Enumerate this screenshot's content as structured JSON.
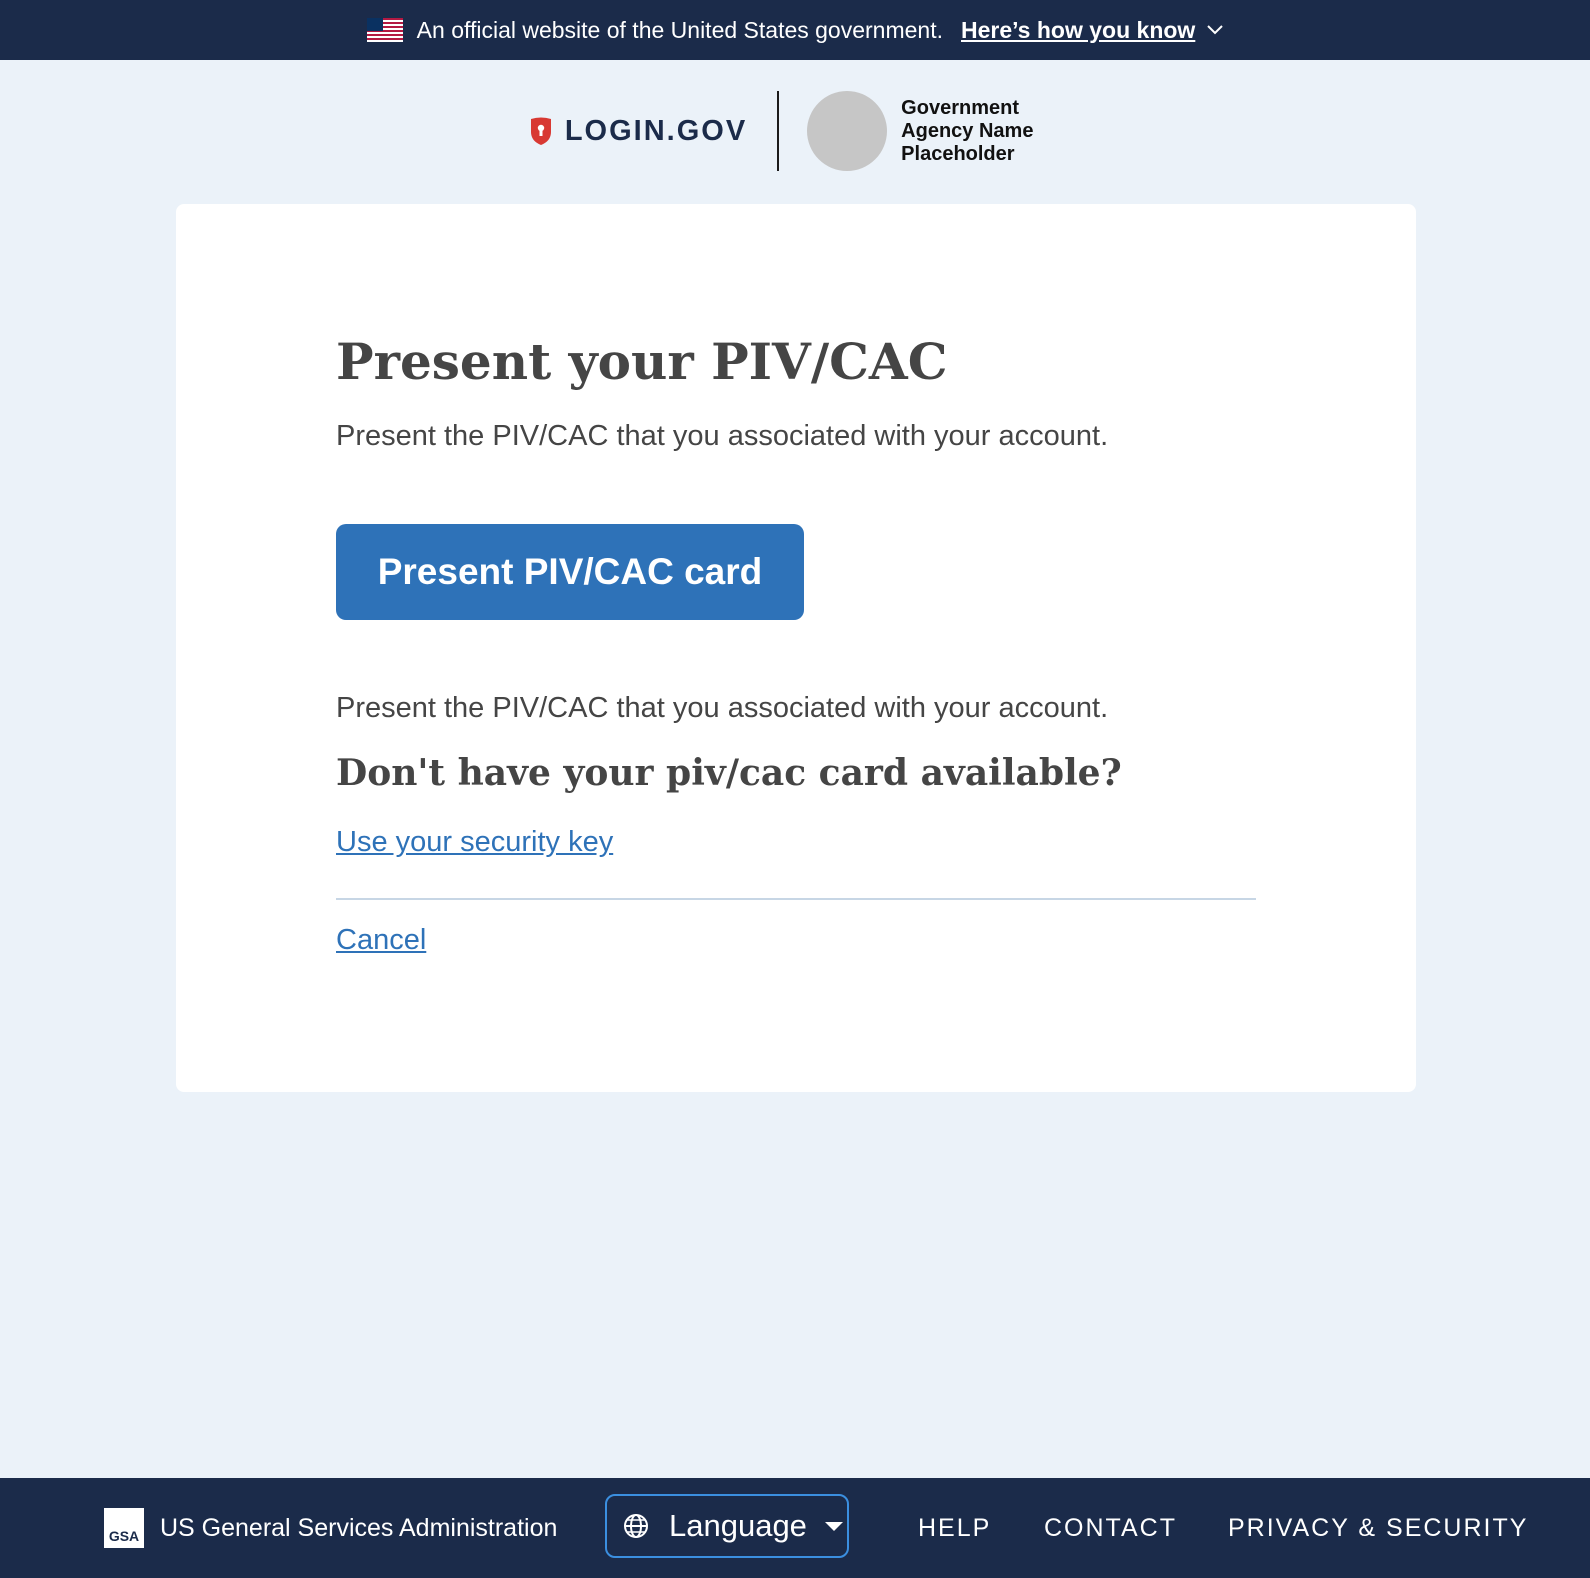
{
  "banner": {
    "official_text": "An official website of the United States government.",
    "how_link": "Here’s how you know"
  },
  "brand": {
    "logo_text": "LOGIN.GOV",
    "agency_name": "Government Agency Name Placeholder"
  },
  "main": {
    "title": "Present your PIV/CAC",
    "lead": "Present the PIV/CAC that you associated with your account.",
    "present_button": "Present PIV/CAC card",
    "secondary_text": "Present the PIV/CAC that you associated with your account.",
    "alt_heading": "Don't have your piv/cac card available?",
    "alt_link": "Use your security key",
    "cancel_link": "Cancel"
  },
  "footer": {
    "gsa_logo_text": "GSA",
    "gsa_text": "US General Services Administration",
    "language_label": "Language",
    "links": [
      "HELP",
      "CONTACT",
      "PRIVACY & SECURITY"
    ]
  },
  "colors": {
    "banner_bg": "#1b2b4a",
    "page_bg": "#ebf2f9",
    "primary": "#2e72b8",
    "shield_red": "#d83933"
  }
}
